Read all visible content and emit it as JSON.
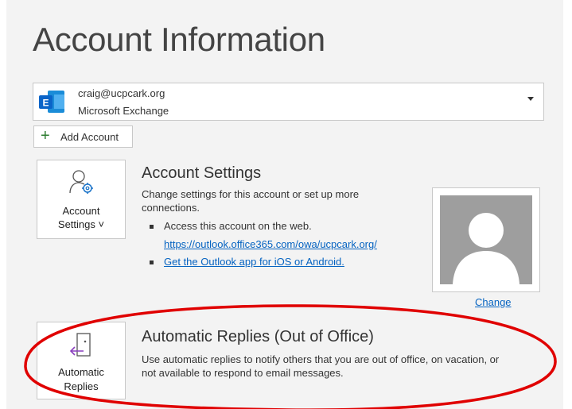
{
  "header": {
    "title": "Account Information"
  },
  "account": {
    "email": "craig@ucpcark.org",
    "type": "Microsoft Exchange"
  },
  "add_account": {
    "label": "Add Account"
  },
  "account_settings": {
    "tile_line1": "Account",
    "tile_line2": "Settings ˅",
    "title": "Account Settings",
    "desc_line1": "Change settings for this account or set up more",
    "desc_line2": "connections.",
    "bullet1": "Access this account on the web.",
    "web_link": "https://outlook.office365.com/owa/ucpcark.org/",
    "app_link": "Get the Outlook app for iOS or Android."
  },
  "profile": {
    "change_label": "Change"
  },
  "automatic_replies": {
    "tile_line1": "Automatic",
    "tile_line2": "Replies",
    "title": "Automatic Replies (Out of Office)",
    "desc_line1": "Use automatic replies to notify others that you are out of office, on vacation, or",
    "desc_line2": "not available to respond to email messages."
  },
  "colors": {
    "accent_link": "#0563c1",
    "annotation": "#e00000",
    "exchange_blue": "#0a64c8"
  }
}
